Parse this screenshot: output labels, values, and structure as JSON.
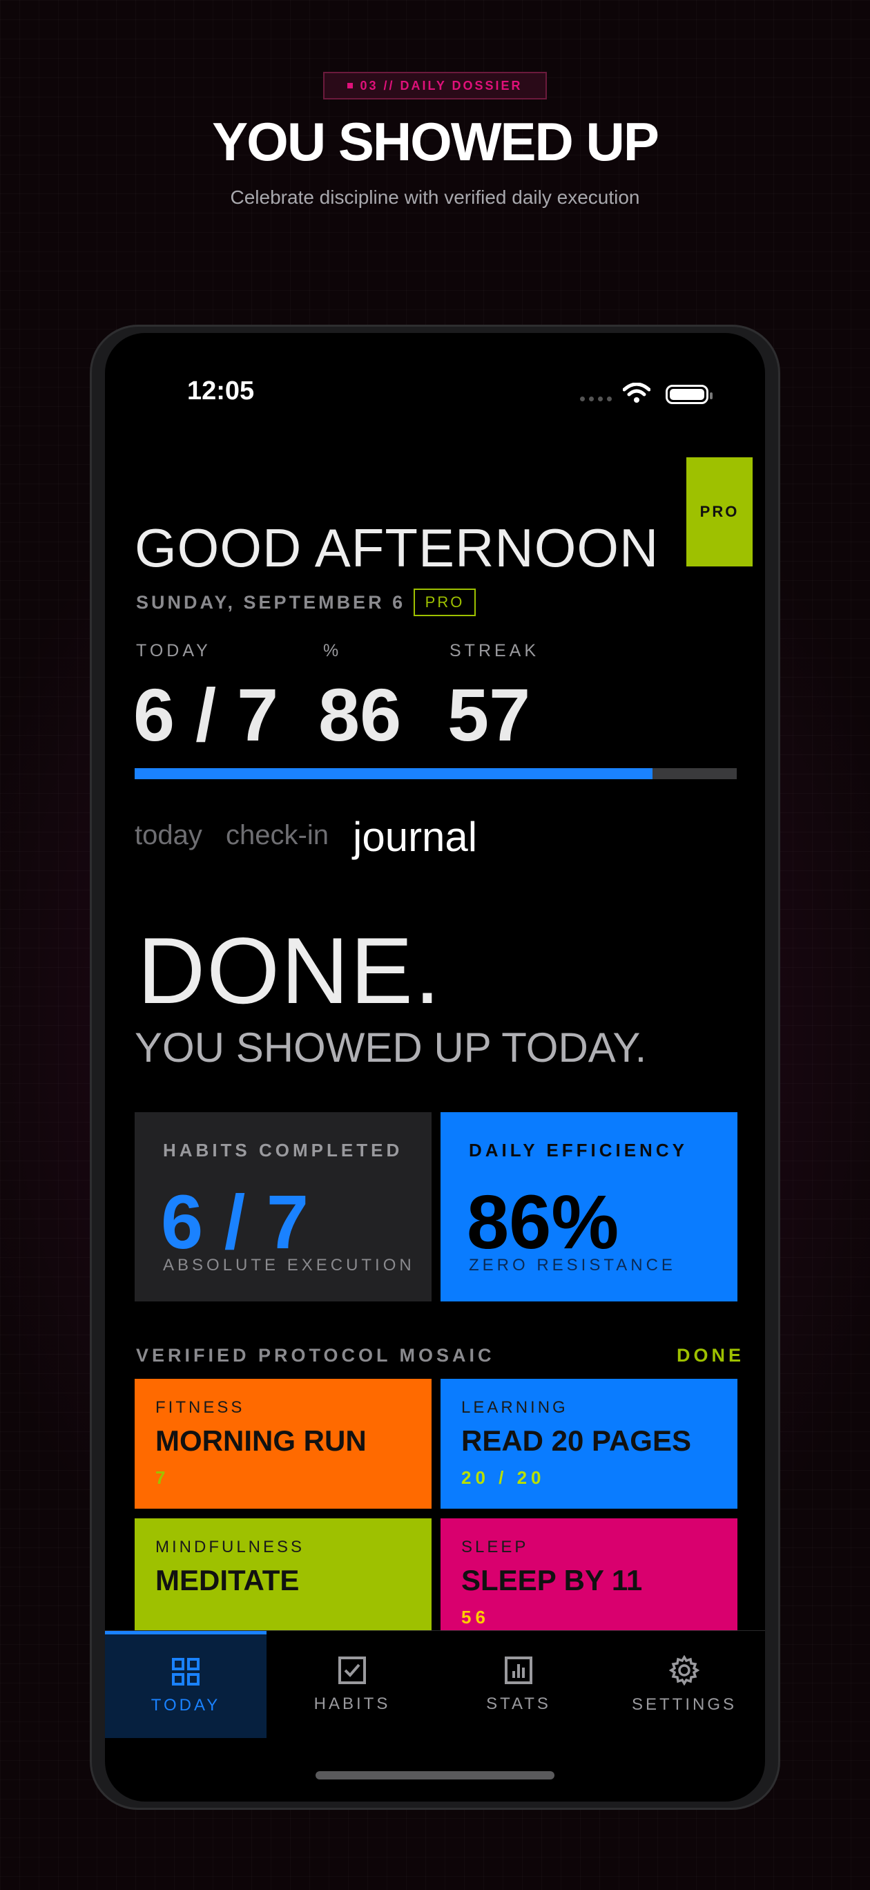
{
  "header": {
    "badge": "03 // DAILY DOSSIER",
    "title": "YOU SHOWED UP",
    "subtitle": "Celebrate discipline with verified daily execution"
  },
  "status_bar": {
    "time": "12:05"
  },
  "app": {
    "pro_badge": "PRO",
    "greeting": "GOOD AFTERNOON",
    "date": "SUNDAY, SEPTEMBER 6",
    "pro_tag": "PRO",
    "stats": [
      {
        "label": "TODAY",
        "value": "6 / 7"
      },
      {
        "label": "%",
        "value": "86"
      },
      {
        "label": "STREAK",
        "value": "57"
      }
    ],
    "progress": 0.86,
    "tabs": {
      "today": "today",
      "checkin": "check-in",
      "journal": "journal"
    },
    "done_title": "DONE.",
    "done_subtitle": "YOU SHOWED UP TODAY.",
    "cards": {
      "habits": {
        "label": "HABITS COMPLETED",
        "value": "6 / 7",
        "sub": "ABSOLUTE EXECUTION"
      },
      "efficiency": {
        "label": "DAILY EFFICIENCY",
        "value": "86%",
        "sub": "ZERO RESISTANCE"
      }
    },
    "mosaic": {
      "heading": "VERIFIED PROTOCOL MOSAIC",
      "status": "DONE",
      "tiles": [
        {
          "category": "FITNESS",
          "name": "MORNING RUN",
          "meta": "7"
        },
        {
          "category": "LEARNING",
          "name": "READ 20 PAGES",
          "meta": "20 / 20"
        },
        {
          "category": "MINDFULNESS",
          "name": "MEDITATE",
          "meta": ""
        },
        {
          "category": "SLEEP",
          "name": "SLEEP BY 11",
          "meta": "56"
        }
      ]
    },
    "nav": [
      {
        "label": "TODAY",
        "icon": "grid-icon",
        "active": true
      },
      {
        "label": "HABITS",
        "icon": "checkbox-icon",
        "active": false
      },
      {
        "label": "STATS",
        "icon": "bar-chart-icon",
        "active": false
      },
      {
        "label": "SETTINGS",
        "icon": "gear-icon",
        "active": false
      }
    ]
  },
  "colors": {
    "accent_blue": "#1a82ff",
    "lime": "#9ec100",
    "orange": "#ff6a00",
    "magenta": "#d9006e",
    "card_dark": "#222224"
  }
}
